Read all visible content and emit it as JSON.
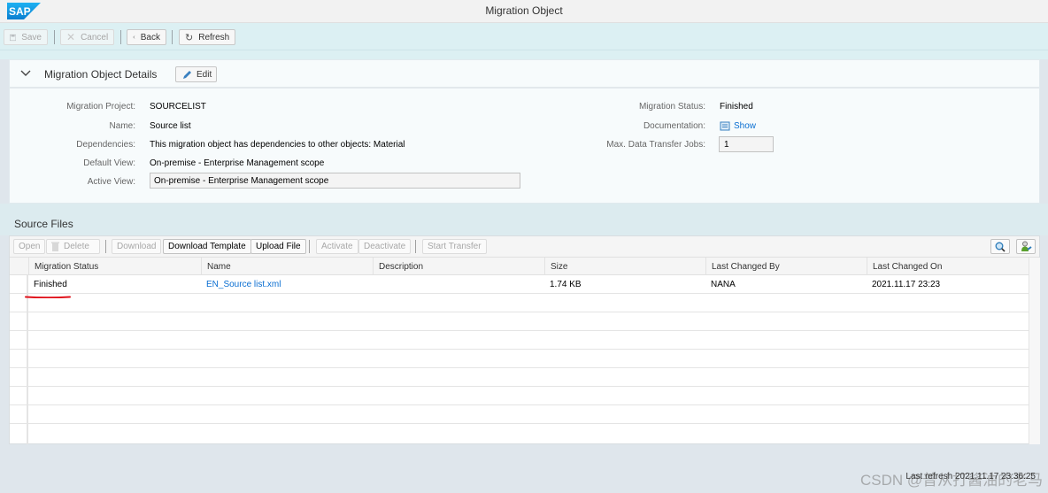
{
  "shell": {
    "logo": "SAP",
    "title": "Migration Object"
  },
  "toolbar": {
    "save_label": "Save",
    "cancel_label": "Cancel",
    "back_label": "Back",
    "refresh_label": "Refresh"
  },
  "details": {
    "title": "Migration Object Details",
    "edit_label": "Edit",
    "left_fields": [
      {
        "label": "Migration Project:",
        "value": "SOURCELIST"
      },
      {
        "label": "Name:",
        "value": "Source list"
      },
      {
        "label": "Dependencies:",
        "value": "This migration object has dependencies to other objects: Material"
      },
      {
        "label": "Default View:",
        "value": "On-premise - Enterprise Management scope"
      },
      {
        "label": "Active View:",
        "value": "On-premise - Enterprise Management scope"
      }
    ],
    "right_fields": [
      {
        "label": "Migration Status:",
        "value": "Finished"
      },
      {
        "label": "Documentation:",
        "value": "Show"
      },
      {
        "label": "Max. Data Transfer Jobs:",
        "value": "1"
      }
    ]
  },
  "source_files": {
    "title": "Source Files",
    "buttons": {
      "open": "Open",
      "delete": "Delete",
      "download": "Download",
      "download_template": "Download Template",
      "upload_file": "Upload File",
      "activate": "Activate",
      "deactivate": "Deactivate",
      "start_transfer": "Start Transfer"
    },
    "columns": [
      "Migration Status",
      "Name",
      "Description",
      "Size",
      "Last Changed By",
      "Last Changed On"
    ],
    "rows": [
      {
        "status": "Finished",
        "name": "EN_Source list.xml",
        "description": "",
        "size": "1.74 KB",
        "changed_by": "NANA",
        "changed_on": "2021.11.17 23:23"
      }
    ]
  },
  "footer": {
    "last_refresh": "Last refresh 2021.11.17 23:36:25",
    "watermark": "CSDN @普从打酱油的老马"
  },
  "colors": {
    "link": "#0a6ed1",
    "annotation_underline": "#e0101a",
    "sap_blue": "#0a8fd8"
  }
}
